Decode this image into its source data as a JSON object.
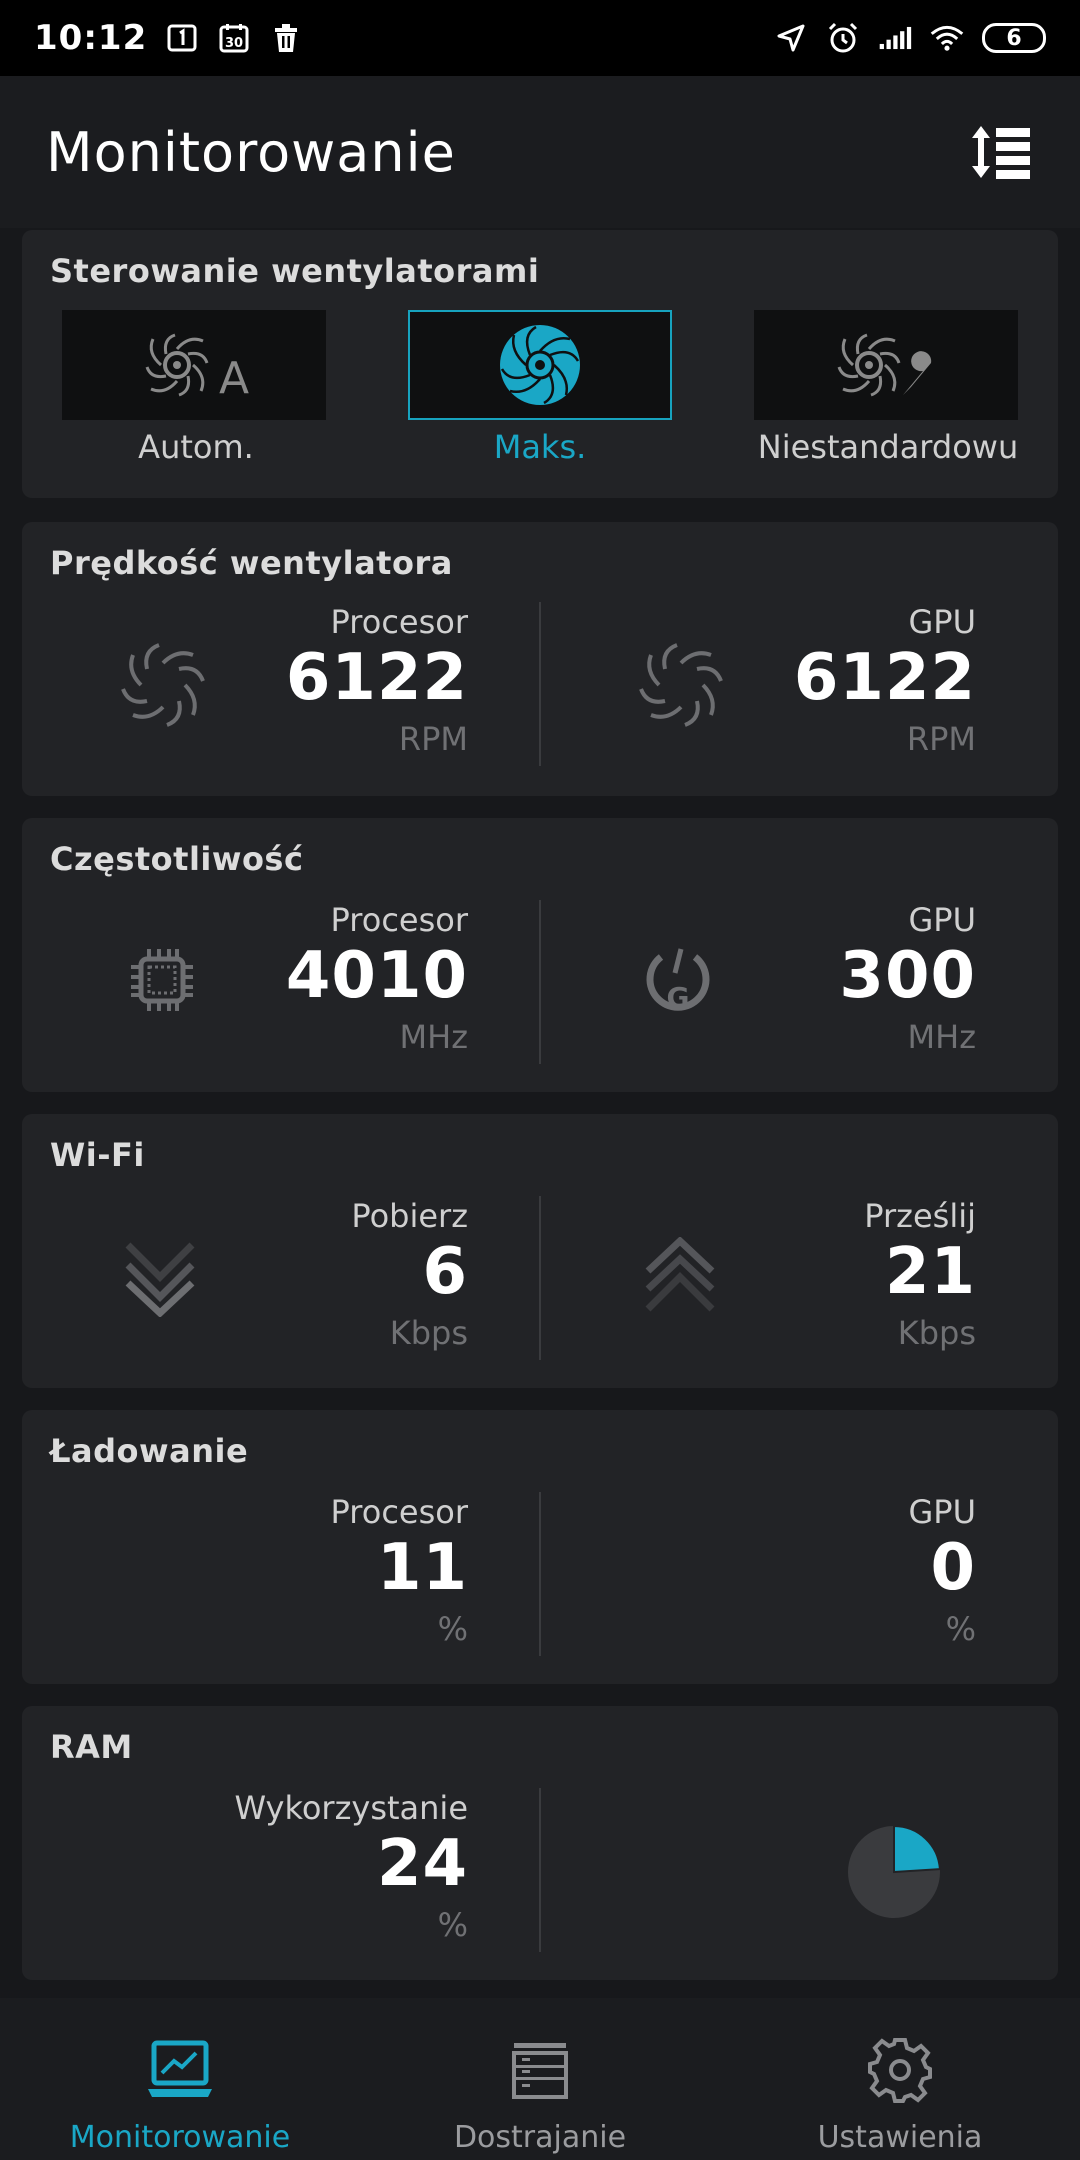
{
  "status_bar": {
    "time": "10:12",
    "battery": "6",
    "icons": [
      "notification-1-icon",
      "calendar-30-icon",
      "trash-icon",
      "location-icon",
      "alarm-icon",
      "signal-icon",
      "wifi-icon",
      "battery-icon"
    ]
  },
  "app_bar": {
    "title": "Monitorowanie",
    "sort_icon": "sort-icon"
  },
  "fan_control": {
    "title": "Sterowanie wentylatorami",
    "modes": [
      {
        "label": "Autom.",
        "icon": "fan-auto-icon",
        "active": false
      },
      {
        "label": "Maks.",
        "icon": "fan-max-icon",
        "active": true
      },
      {
        "label": "Niestandardowu",
        "icon": "fan-custom-icon",
        "active": false
      }
    ],
    "accent_color": "#1aa7c6"
  },
  "fan_speed": {
    "title": "Prędkość wentylatora",
    "cpu": {
      "label": "Procesor",
      "value": "6122",
      "unit": "RPM"
    },
    "gpu": {
      "label": "GPU",
      "value": "6122",
      "unit": "RPM"
    }
  },
  "frequency": {
    "title": "Częstotliwość",
    "cpu": {
      "label": "Procesor",
      "value": "4010",
      "unit": "MHz"
    },
    "gpu": {
      "label": "GPU",
      "value": "300",
      "unit": "MHz"
    }
  },
  "wifi": {
    "title": "Wi-Fi",
    "download": {
      "label": "Pobierz",
      "value": "6",
      "unit": "Kbps"
    },
    "upload": {
      "label": "Prześlij",
      "value": "21",
      "unit": "Kbps"
    }
  },
  "load": {
    "title": "Ładowanie",
    "cpu": {
      "label": "Procesor",
      "value": "11",
      "unit": "%"
    },
    "gpu": {
      "label": "GPU",
      "value": "0",
      "unit": "%"
    }
  },
  "ram": {
    "title": "RAM",
    "usage": {
      "label": "Wykorzystanie",
      "value": "24",
      "unit": "%"
    },
    "usage_fraction": 0.24
  },
  "bottom_nav": [
    {
      "label": "Monitorowanie",
      "icon": "monitor-chart-icon",
      "active": true
    },
    {
      "label": "Dostrajanie",
      "icon": "tuning-list-icon",
      "active": false
    },
    {
      "label": "Ustawienia",
      "icon": "gear-icon",
      "active": false
    }
  ]
}
